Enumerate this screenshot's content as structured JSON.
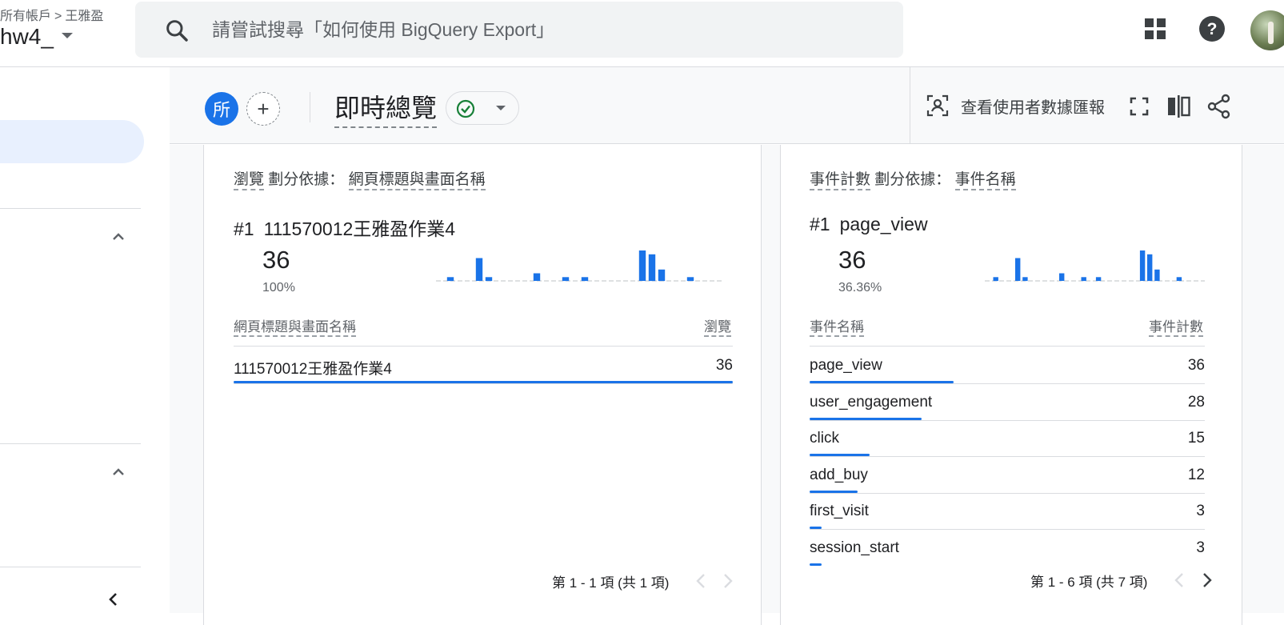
{
  "header": {
    "breadcrumb": [
      "所有帳戶",
      "王雅盈"
    ],
    "breadcrumb_sep": ">",
    "account_name": "hw4_",
    "search_placeholder": "請嘗試搜尋「如何使用 BigQuery Export」"
  },
  "toolbar": {
    "comparison_chip": "所",
    "add_comparison": "+",
    "title": "即時總覽",
    "user_snapshot": "查看使用者數據匯報"
  },
  "card_pages": {
    "metric": "瀏覽",
    "split_by": "劃分依據：",
    "dimension": "網頁標題與畫面名稱",
    "rank": "#1",
    "top_item": "111570012王雅盈作業4",
    "top_value": "36",
    "top_percent": "100%",
    "col_dimension": "網頁標題與畫面名稱",
    "col_metric": "瀏覽",
    "rows": [
      {
        "label": "111570012王雅盈作業4",
        "value": "36",
        "share": 1.0
      }
    ],
    "pager": "第 1 - 1 項 (共 1 項)"
  },
  "card_events": {
    "metric": "事件計數",
    "split_by": "劃分依據：",
    "dimension": "事件名稱",
    "rank": "#1",
    "top_item": "page_view",
    "top_value": "36",
    "top_percent": "36.36%",
    "col_dimension": "事件名稱",
    "col_metric": "事件計數",
    "rows": [
      {
        "label": "page_view",
        "value": "36",
        "share": 0.3636
      },
      {
        "label": "user_engagement",
        "value": "28",
        "share": 0.2828
      },
      {
        "label": "click",
        "value": "15",
        "share": 0.1515
      },
      {
        "label": "add_buy",
        "value": "12",
        "share": 0.1212
      },
      {
        "label": "first_visit",
        "value": "3",
        "share": 0.0303
      },
      {
        "label": "session_start",
        "value": "3",
        "share": 0.0303
      }
    ],
    "pager": "第 1 - 6 項 (共 7 項)"
  },
  "chart_data": [
    {
      "type": "bar",
      "values": [
        0,
        1,
        0,
        0,
        6,
        1,
        0,
        0,
        0,
        0,
        2,
        0,
        0,
        1,
        0,
        1,
        0,
        0,
        0,
        0,
        0,
        8,
        7,
        3,
        0,
        0,
        1,
        0,
        0,
        0
      ]
    },
    {
      "type": "bar",
      "values": [
        0,
        1,
        0,
        0,
        6,
        1,
        0,
        0,
        0,
        0,
        2,
        0,
        0,
        1,
        0,
        1,
        0,
        0,
        0,
        0,
        0,
        8,
        7,
        3,
        0,
        0,
        1,
        0,
        0,
        0
      ]
    }
  ],
  "colors": {
    "accent": "#1a73e8",
    "success": "#188038"
  },
  "icons": [
    "search-icon",
    "apps-icon",
    "help-icon",
    "check-circle-icon",
    "user-snapshot-icon",
    "fullscreen-icon",
    "compare-icon",
    "share-icon",
    "chevron-up-icon",
    "chevron-left-icon",
    "chevron-right-icon"
  ]
}
